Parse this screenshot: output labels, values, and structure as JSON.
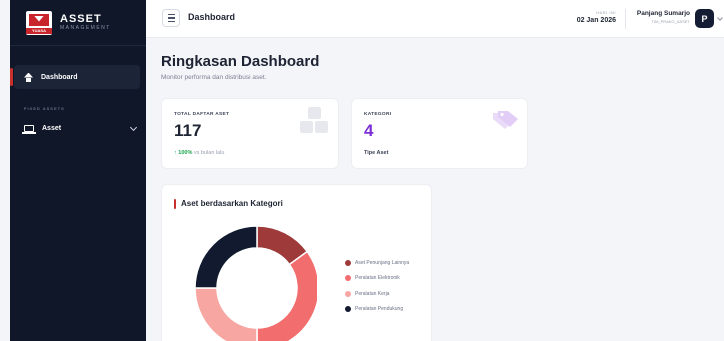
{
  "brand": {
    "name": "ASSET",
    "tagline": "MANAGEMENT",
    "logo_word": "YUASA"
  },
  "sidebar": {
    "active_item": {
      "label": "Dashboard",
      "icon": "home-icon"
    },
    "section_label": "FIXED ASSETS",
    "items": [
      {
        "label": "Asset",
        "icon": "monitor-icon"
      }
    ]
  },
  "header": {
    "title": "Dashboard",
    "date_label": "HARI INI",
    "date_value": "02 Jan 2026",
    "user_name": "Panjang Sumarjo",
    "user_role": "TIM_PRAKO_ASSET",
    "avatar_initial": "P"
  },
  "page": {
    "title": "Ringkasan Dashboard",
    "subtitle": "Monitor performa dan distribusi aset."
  },
  "cards": {
    "total": {
      "label": "TOTAL DAFTAR ASET",
      "value": "117",
      "trend_value": "↑ 100%",
      "trend_text": " vs bulan lalu"
    },
    "kategori": {
      "label": "KATEGORI",
      "value": "4",
      "foot": "Tipe Aset"
    }
  },
  "colors": {
    "accent": "#c9302c",
    "purple": "#7c2fd6",
    "green": "#19a34a",
    "sidebar": "#0f1729"
  },
  "chart_data": {
    "type": "pie",
    "title": "Aset berdasarkan Kategori",
    "donut": true,
    "legend_position": "right",
    "series": [
      {
        "name": "Aset Penunjang Lainnya",
        "value": 15,
        "color": "#9e3a3a"
      },
      {
        "name": "Peralatan Elektronik",
        "value": 35,
        "color": "#f26d6d"
      },
      {
        "name": "Peralatan Kerja",
        "value": 25,
        "color": "#f7a6a2"
      },
      {
        "name": "Peralatan Pendukung",
        "value": 25,
        "color": "#111a2e"
      }
    ]
  }
}
